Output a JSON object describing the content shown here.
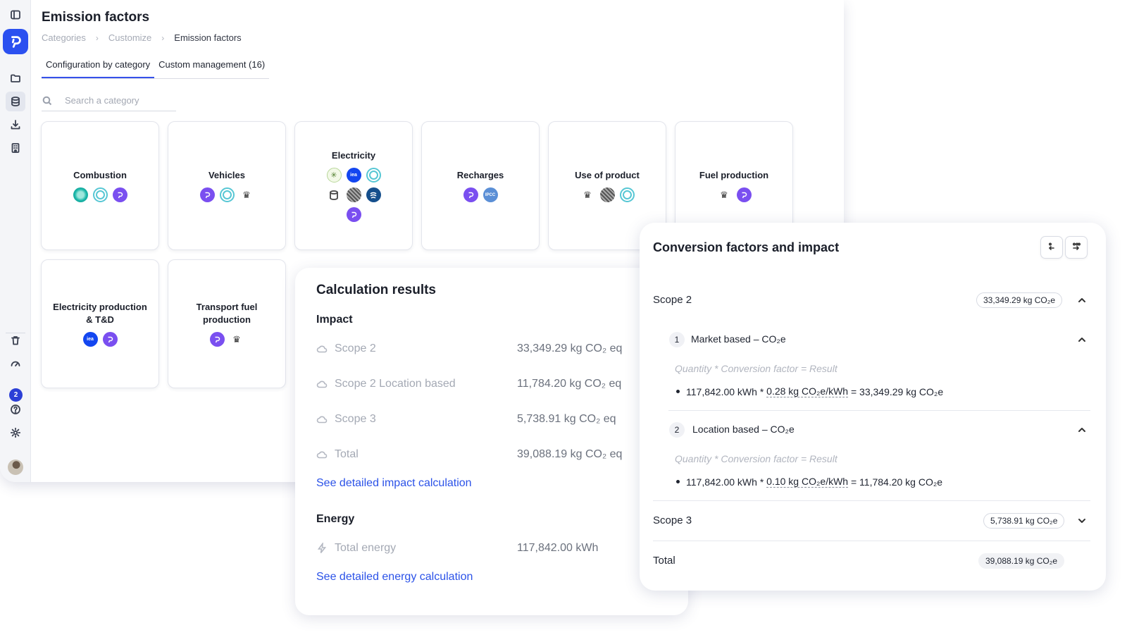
{
  "page": {
    "title": "Emission factors",
    "breadcrumb": [
      "Categories",
      "Customize",
      "Emission factors"
    ],
    "tabs": [
      "Configuration by category",
      "Custom management (16)"
    ],
    "search_placeholder": "Search a category"
  },
  "sidebar": {
    "notification_count": "2"
  },
  "categories": [
    {
      "name": "Combustion"
    },
    {
      "name": "Vehicles"
    },
    {
      "name": "Electricity"
    },
    {
      "name": "Recharges"
    },
    {
      "name": "Use of product"
    },
    {
      "name": "Fuel production"
    },
    {
      "name": "Electricity production & T&D"
    },
    {
      "name": "Transport fuel production"
    }
  ],
  "source_badges": {
    "iea": "iea",
    "ipcc": "IPCC"
  },
  "calculation": {
    "title": "Calculation results",
    "impact_heading": "Impact",
    "rows": [
      {
        "label": "Scope 2",
        "value": "33,349.29 kg CO₂ eq"
      },
      {
        "label": "Scope 2 Location based",
        "value": "11,784.20 kg CO₂ eq"
      },
      {
        "label": "Scope 3",
        "value": "5,738.91 kg CO₂ eq"
      },
      {
        "label": "Total",
        "value": "39,088.19 kg CO₂ eq"
      }
    ],
    "impact_link": "See detailed impact calculation",
    "energy_heading": "Energy",
    "energy_row": {
      "label": "Total energy",
      "value": "117,842.00 kWh"
    },
    "energy_link": "See detailed energy calculation"
  },
  "conversion": {
    "title": "Conversion factors and impact",
    "scope2": {
      "label": "Scope 2",
      "value": "33,349.29 kg CO₂e"
    },
    "items": [
      {
        "index": "1",
        "label": "Market based – CO₂e",
        "hint": "Quantity * Conversion factor = Result",
        "quantity": "117,842.00 kWh",
        "op": "*",
        "factor": "0.28 kg CO₂e/kWh",
        "result": "= 33,349.29 kg CO₂e"
      },
      {
        "index": "2",
        "label": "Location based – CO₂e",
        "hint": "Quantity * Conversion factor = Result",
        "quantity": "117,842.00 kWh",
        "op": "*",
        "factor": "0.10 kg CO₂e/kWh",
        "result": "= 11,784.20 kg CO₂e"
      }
    ],
    "scope3": {
      "label": "Scope 3",
      "value": "5,738.91 kg CO₂e"
    },
    "total": {
      "label": "Total",
      "value": "39,088.19 kg CO₂e"
    }
  },
  "colors": {
    "accent": "#2b52e8",
    "brand": "#7a4ff0",
    "logo": "#2b50f0"
  }
}
